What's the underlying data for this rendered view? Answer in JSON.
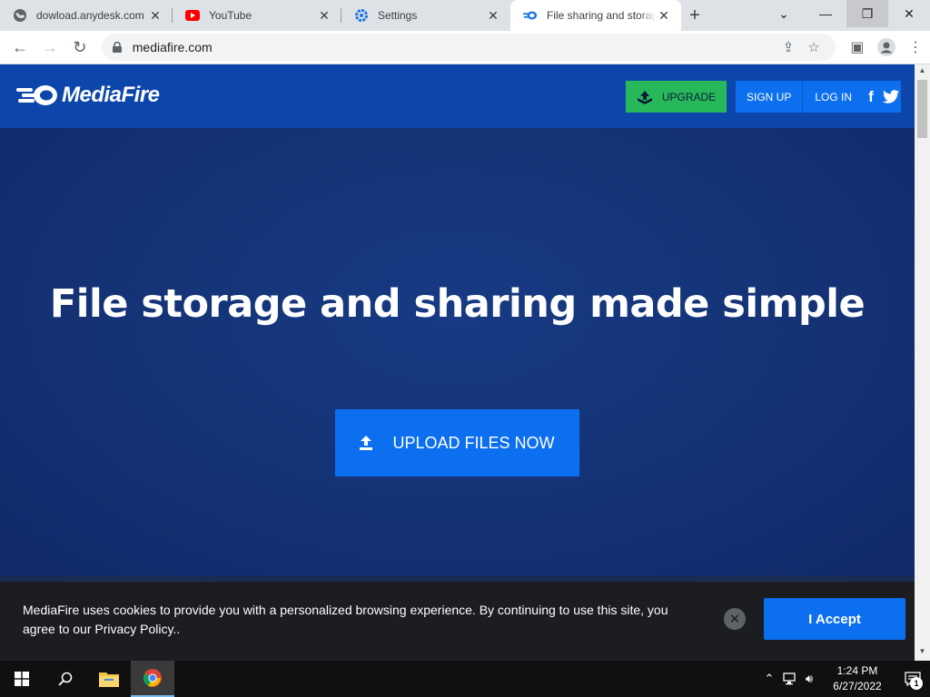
{
  "browser": {
    "tabs": [
      {
        "title": "dowload.anydesk.com",
        "icon": "globe-icon"
      },
      {
        "title": "YouTube",
        "icon": "youtube-icon"
      },
      {
        "title": "Settings",
        "icon": "settings-gear-icon"
      },
      {
        "title": "File sharing and storage made simple",
        "icon": "mediafire-icon"
      }
    ],
    "active_tab_index": 3,
    "url": "mediafire.com"
  },
  "site": {
    "logo_text": "MediaFire",
    "header": {
      "upgrade_label": "UPGRADE",
      "signup_label": "SIGN UP",
      "login_label": "LOG IN",
      "facebook_glyph": "f"
    },
    "hero": {
      "title": "File storage and sharing made simple",
      "upload_label": "UPLOAD FILES NOW"
    },
    "cookie_banner": {
      "message": "MediaFire uses cookies to provide you with a personalized browsing experience. By continuing to use this site, you agree to our Privacy Policy..",
      "accept_label": "I Accept"
    }
  },
  "taskbar": {
    "time": "1:24 PM",
    "date": "6/27/2022",
    "notification_count": "1"
  },
  "colors": {
    "header_bg": "#0c46ab",
    "hero_bg": "#143274",
    "button_blue": "#0b6ff0",
    "upgrade_green": "#27b85a",
    "cookie_bg": "#1b1d21"
  }
}
